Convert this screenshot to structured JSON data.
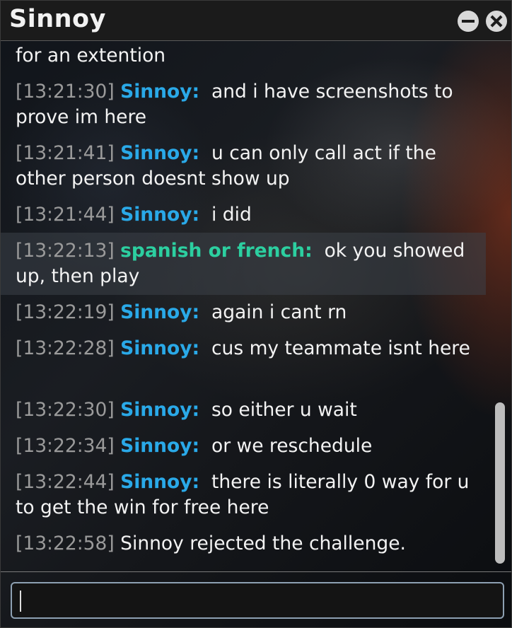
{
  "window": {
    "title": "Sinnoy"
  },
  "titlebar": {
    "minimize_icon": "minimize-icon",
    "close_icon": "close-icon"
  },
  "colors": {
    "timestamp": "#9a9a9a",
    "nick_blue": "#2aa9e8",
    "nick_green": "#2ccfa0",
    "text": "#f3f3f3"
  },
  "messages": [
    {
      "time": "",
      "nick": "",
      "text": "for an extention"
    },
    {
      "time": "[13:21:30]",
      "nick": "Sinnoy:",
      "text": "and i have screenshots to prove im here"
    },
    {
      "time": "[13:21:41]",
      "nick": "Sinnoy:",
      "text": "u can only call act if the other person doesnt show up"
    },
    {
      "time": "[13:21:44]",
      "nick": "Sinnoy:",
      "text": "i did"
    },
    {
      "time": "[13:22:13]",
      "nick": "spanish or french:",
      "text": "ok you showed up, then play"
    },
    {
      "time": "[13:22:19]",
      "nick": "Sinnoy:",
      "text": "again i cant rn"
    },
    {
      "time": "[13:22:28]",
      "nick": "Sinnoy:",
      "text": "cus my teammate isnt here"
    },
    {
      "time": "[13:22:30]",
      "nick": "Sinnoy:",
      "text": "so either u wait"
    },
    {
      "time": "[13:22:34]",
      "nick": "Sinnoy:",
      "text": "or we reschedule"
    },
    {
      "time": "[13:22:44]",
      "nick": "Sinnoy:",
      "text": "there is literally 0 way for u to get the win for free here"
    },
    {
      "time": "[13:22:58]",
      "nick": "",
      "text": "Sinnoy rejected the challenge."
    }
  ],
  "input": {
    "value": "",
    "placeholder": ""
  }
}
